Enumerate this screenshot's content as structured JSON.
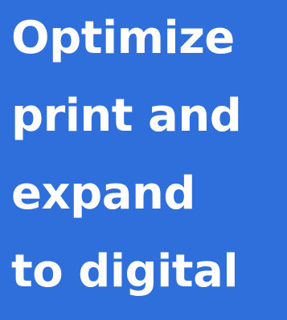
{
  "headline": {
    "lines": [
      "Optimize",
      "print and",
      "expand",
      "to digital"
    ]
  },
  "colors": {
    "background": "#2f6fdc",
    "text": "#ffffff"
  }
}
